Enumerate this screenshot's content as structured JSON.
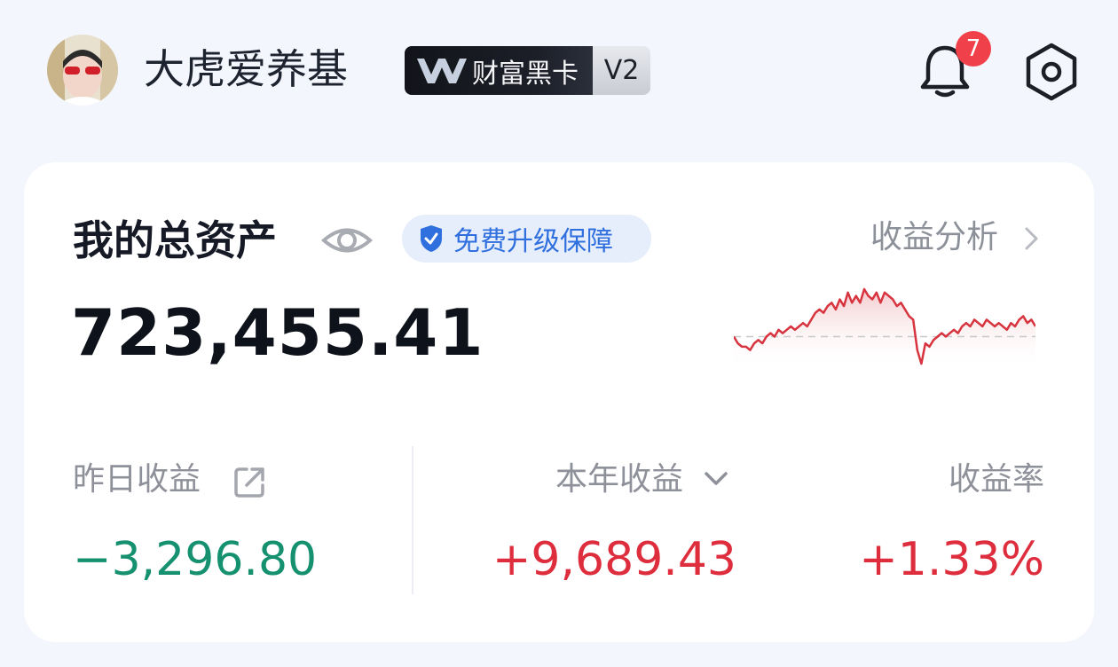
{
  "header": {
    "username": "大虎爱养基",
    "badge_text": "财富黑卡",
    "badge_level": "V2",
    "notification_count": "7"
  },
  "summary": {
    "title": "我的总资产",
    "protect_label": "免费升级保障",
    "analysis_label": "收益分析",
    "total_assets": "723,455.41"
  },
  "stats": {
    "yesterday_label": "昨日收益",
    "yesterday_value": "−3,296.80",
    "year_label": "本年收益",
    "year_value": "+9,689.43",
    "rate_label": "收益率",
    "rate_value": "+1.33%"
  },
  "chart_data": {
    "type": "line",
    "values": [
      0,
      -2,
      -3,
      -3,
      -4,
      -2,
      -1,
      -2,
      0,
      1,
      0,
      2,
      1,
      2,
      3,
      2,
      3,
      4,
      3,
      5,
      7,
      8,
      7,
      9,
      10,
      8,
      11,
      9,
      13,
      10,
      12,
      10,
      14,
      12,
      11,
      13,
      10,
      13,
      12,
      11,
      9,
      10,
      8,
      6,
      5,
      -4,
      -8,
      -2,
      -3,
      -1,
      0,
      1,
      0,
      1,
      2,
      1,
      3,
      4,
      3,
      5,
      4,
      3,
      5,
      4,
      3,
      4,
      3,
      2,
      4,
      3,
      5,
      6,
      4,
      5,
      3
    ],
    "colors": {
      "line": "#d8343f",
      "fill": "#f6d4d6",
      "baseline": "#c9c9c9"
    }
  },
  "colors": {
    "negative": "#159170",
    "positive": "#de2e3e",
    "accent": "#2f6fde"
  },
  "icons": [
    "avatar",
    "vip-logo",
    "bell-icon",
    "settings-icon",
    "eye-icon",
    "shield-icon",
    "chevron-right-icon",
    "share-icon",
    "chevron-down-icon"
  ]
}
